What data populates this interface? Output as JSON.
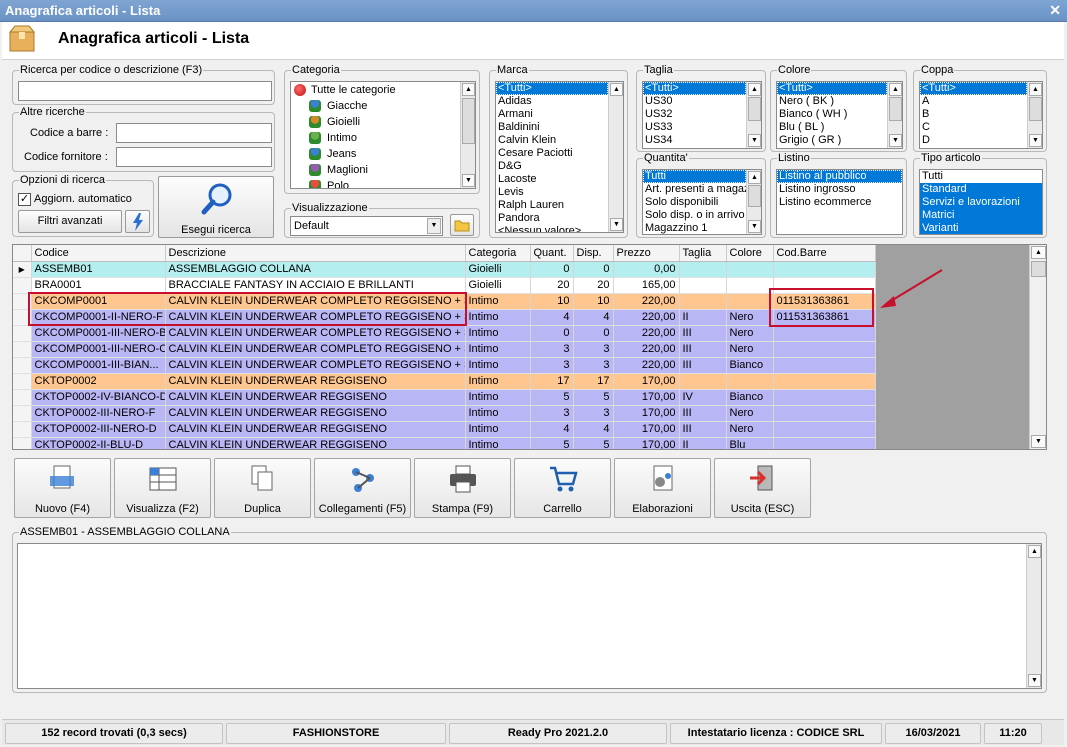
{
  "window": {
    "title": "Anagrafica articoli  - Lista"
  },
  "header": {
    "title": "Anagrafica articoli  - Lista"
  },
  "search": {
    "legend": "Ricerca per codice o descrizione (F3)",
    "value": ""
  },
  "altre": {
    "legend": "Altre ricerche",
    "barcode_label": "Codice a barre :",
    "supplier_label": "Codice fornitore :"
  },
  "opzioni": {
    "legend": "Opzioni di ricerca",
    "auto_label": "Aggiorn. automatico",
    "auto_checked": true,
    "filters_label": "Filtri avanzati",
    "search_button": "Esegui ricerca"
  },
  "categoria": {
    "legend": "Categoria",
    "root": "Tutte le categorie",
    "items": [
      "Giacche",
      "Gioielli",
      "Intimo",
      "Jeans",
      "Maglioni",
      "Polo"
    ]
  },
  "visualizzazione": {
    "legend": "Visualizzazione",
    "value": "Default"
  },
  "marca": {
    "legend": "Marca",
    "items": [
      "<Tutti>",
      "Adidas",
      "Armani",
      "Baldinini",
      "Calvin Klein",
      "Cesare Paciotti",
      "D&G",
      "Lacoste",
      "Levis",
      "Ralph Lauren",
      "Pandora",
      "<Nessun valore>"
    ]
  },
  "taglia": {
    "legend": "Taglia",
    "items": [
      "<Tutti>",
      "US30",
      "US32",
      "US33",
      "US34"
    ]
  },
  "colore": {
    "legend": "Colore",
    "items": [
      "<Tutti>",
      "Nero ( BK )",
      "Bianco ( WH )",
      "Blu ( BL )",
      "Grigio ( GR )"
    ]
  },
  "coppa": {
    "legend": "Coppa",
    "items": [
      "<Tutti>",
      "A",
      "B",
      "C",
      "D"
    ]
  },
  "quantita": {
    "legend": "Quantita'",
    "items": [
      "Tutti",
      "Art. presenti a magazzino",
      "Solo disponibili",
      "Solo disp. o in arrivo",
      "Magazzino 1"
    ]
  },
  "listino": {
    "legend": "Listino",
    "items": [
      "Listino al pubblico",
      "Listino ingrosso",
      "Listino ecommerce"
    ]
  },
  "tipo": {
    "legend": "Tipo articolo",
    "items": [
      "Tutti",
      "Standard",
      "Servizi e lavorazioni",
      "Matrici",
      "Varianti"
    ]
  },
  "grid": {
    "columns": [
      "Codice",
      "Descrizione",
      "Categoria",
      "Quant.",
      "Disp.",
      "Prezzo",
      "Taglia",
      "Colore",
      "Cod.Barre"
    ],
    "rows": [
      {
        "c": [
          "ASSEMB01",
          "ASSEMBLAGGIO COLLANA",
          "Gioielli",
          "0",
          "0",
          "0,00",
          "",
          "",
          ""
        ],
        "color": "cyan",
        "current": true
      },
      {
        "c": [
          "BRA0001",
          "BRACCIALE FANTASY IN ACCIAIO E BRILLANTI",
          "Gioielli",
          "20",
          "20",
          "165,00",
          "",
          "",
          ""
        ],
        "color": "white"
      },
      {
        "c": [
          "CKCOMP0001",
          "CALVIN KLEIN UNDERWEAR COMPLETO REGGISENO + SLIP",
          "Intimo",
          "10",
          "10",
          "220,00",
          "",
          "",
          "011531363861"
        ],
        "color": "orange"
      },
      {
        "c": [
          "CKCOMP0001-II-NERO-F",
          "CALVIN KLEIN UNDERWEAR COMPLETO REGGISENO + SLIP",
          "Intimo",
          "4",
          "4",
          "220,00",
          "II",
          "Nero",
          "011531363861"
        ],
        "color": "lav"
      },
      {
        "c": [
          "CKCOMP0001-III-NERO-B",
          "CALVIN KLEIN UNDERWEAR COMPLETO REGGISENO + SLIP",
          "Intimo",
          "0",
          "0",
          "220,00",
          "III",
          "Nero",
          ""
        ],
        "color": "lav"
      },
      {
        "c": [
          "CKCOMP0001-III-NERO-C",
          "CALVIN KLEIN UNDERWEAR COMPLETO REGGISENO + SLIP",
          "Intimo",
          "3",
          "3",
          "220,00",
          "III",
          "Nero",
          ""
        ],
        "color": "lav"
      },
      {
        "c": [
          "CKCOMP0001-III-BIAN...",
          "CALVIN KLEIN UNDERWEAR COMPLETO REGGISENO + SLIP",
          "Intimo",
          "3",
          "3",
          "220,00",
          "III",
          "Bianco",
          ""
        ],
        "color": "lav"
      },
      {
        "c": [
          "CKTOP0002",
          "CALVIN KLEIN UNDERWEAR REGGISENO",
          "Intimo",
          "17",
          "17",
          "170,00",
          "",
          "",
          ""
        ],
        "color": "orange"
      },
      {
        "c": [
          "CKTOP0002-IV-BIANCO-D",
          "CALVIN KLEIN UNDERWEAR REGGISENO",
          "Intimo",
          "5",
          "5",
          "170,00",
          "IV",
          "Bianco",
          ""
        ],
        "color": "lav"
      },
      {
        "c": [
          "CKTOP0002-III-NERO-F",
          "CALVIN KLEIN UNDERWEAR REGGISENO",
          "Intimo",
          "3",
          "3",
          "170,00",
          "III",
          "Nero",
          ""
        ],
        "color": "lav"
      },
      {
        "c": [
          "CKTOP0002-III-NERO-D",
          "CALVIN KLEIN UNDERWEAR REGGISENO",
          "Intimo",
          "4",
          "4",
          "170,00",
          "III",
          "Nero",
          ""
        ],
        "color": "lav"
      },
      {
        "c": [
          "CKTOP0002-II-BLU-D",
          "CALVIN KLEIN UNDERWEAR REGGISENO",
          "Intimo",
          "5",
          "5",
          "170,00",
          "II",
          "Blu",
          ""
        ],
        "color": "lav"
      }
    ]
  },
  "toolbar": [
    {
      "label": "Nuovo (F4)",
      "icon": "new-icon"
    },
    {
      "label": "Visualizza (F2)",
      "icon": "view-grid-icon"
    },
    {
      "label": "Duplica",
      "icon": "duplicate-icon"
    },
    {
      "label": "Collegamenti (F5)",
      "icon": "links-icon"
    },
    {
      "label": "Stampa (F9)",
      "icon": "printer-icon"
    },
    {
      "label": "Carrello",
      "icon": "cart-icon"
    },
    {
      "label": "Elaborazioni",
      "icon": "gears-icon"
    },
    {
      "label": "Uscita (ESC)",
      "icon": "exit-icon"
    }
  ],
  "detail": {
    "legend": "ASSEMB01 - ASSEMBLAGGIO COLLANA",
    "text": ""
  },
  "status": {
    "records": "152 record trovati (0,3 secs)",
    "store": "FASHIONSTORE",
    "version": "Ready Pro 2021.2.0",
    "license": "Intestatario licenza : CODICE SRL",
    "date": "16/03/2021",
    "time": "11:20"
  },
  "colors": {
    "accent": "#0078d7",
    "highlight": "#c8102e",
    "cyan_row": "#b4eeee",
    "orange_row": "#ffc78f",
    "lavender_row": "#b9b6f5"
  }
}
